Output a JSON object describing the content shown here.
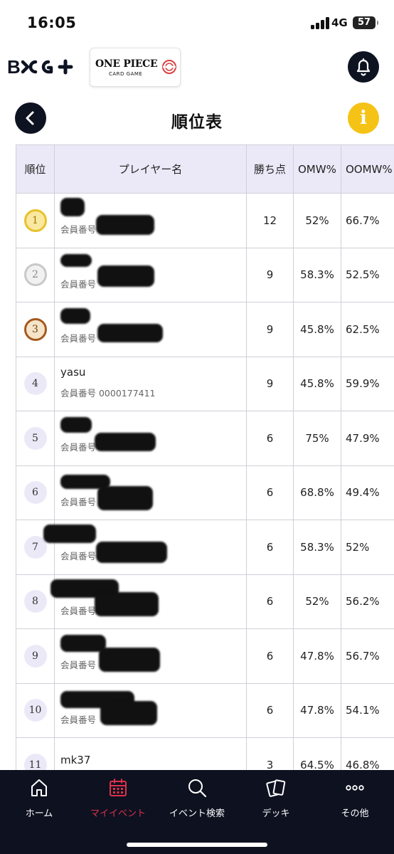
{
  "status_bar": {
    "time": "16:05",
    "network": "4G",
    "battery": "57"
  },
  "header": {
    "bcg_logo": "B",
    "op_logo_title": "ONE PIECE",
    "op_logo_subtitle": "CARD GAME"
  },
  "page": {
    "title": "順位表",
    "info_label": "i"
  },
  "table": {
    "headers": {
      "rank": "順位",
      "player": "プレイヤー名",
      "points": "勝ち点",
      "omw": "OMW%",
      "oomw": "OOMW%"
    },
    "member_label": "会員番号",
    "rows": [
      {
        "rank": "1",
        "name": "",
        "member": "会員番号",
        "points": "12",
        "omw": "52%",
        "oomw": "66.7%"
      },
      {
        "rank": "2",
        "name": "",
        "member": "会員番号",
        "points": "9",
        "omw": "58.3%",
        "oomw": "52.5%"
      },
      {
        "rank": "3",
        "name": "",
        "member": "会員番号",
        "points": "9",
        "omw": "45.8%",
        "oomw": "62.5%"
      },
      {
        "rank": "4",
        "name": "yasu",
        "member": "会員番号 0000177411",
        "points": "9",
        "omw": "45.8%",
        "oomw": "59.9%"
      },
      {
        "rank": "5",
        "name": "",
        "member": "会員番号",
        "points": "6",
        "omw": "75%",
        "oomw": "47.9%"
      },
      {
        "rank": "6",
        "name": "",
        "member": "会員番号",
        "points": "6",
        "omw": "68.8%",
        "oomw": "49.4%"
      },
      {
        "rank": "7",
        "name": "",
        "member": "会員番号",
        "points": "6",
        "omw": "58.3%",
        "oomw": "52%"
      },
      {
        "rank": "8",
        "name": "",
        "member": "会員番号",
        "points": "6",
        "omw": "52%",
        "oomw": "56.2%"
      },
      {
        "rank": "9",
        "name": "",
        "member": "会員番号",
        "points": "6",
        "omw": "47.8%",
        "oomw": "56.7%"
      },
      {
        "rank": "10",
        "name": "",
        "member": "会員番号",
        "points": "6",
        "omw": "47.8%",
        "oomw": "54.1%"
      },
      {
        "rank": "11",
        "name": "mk37",
        "member": "",
        "points": "3",
        "omw": "64.5%",
        "oomw": "46.8%"
      }
    ]
  },
  "bottom_nav": [
    {
      "label": "ホーム",
      "icon": "home-icon",
      "active": false
    },
    {
      "label": "マイイベント",
      "icon": "calendar-icon",
      "active": true
    },
    {
      "label": "イベント検索",
      "icon": "search-icon",
      "active": false
    },
    {
      "label": "デッキ",
      "icon": "cards-icon",
      "active": false
    },
    {
      "label": "その他",
      "icon": "more-icon",
      "active": false
    }
  ],
  "colors": {
    "nav_bg": "#0d1120",
    "active": "#e0304a",
    "info": "#f5c316",
    "header_bg": "#ebe9f7"
  }
}
